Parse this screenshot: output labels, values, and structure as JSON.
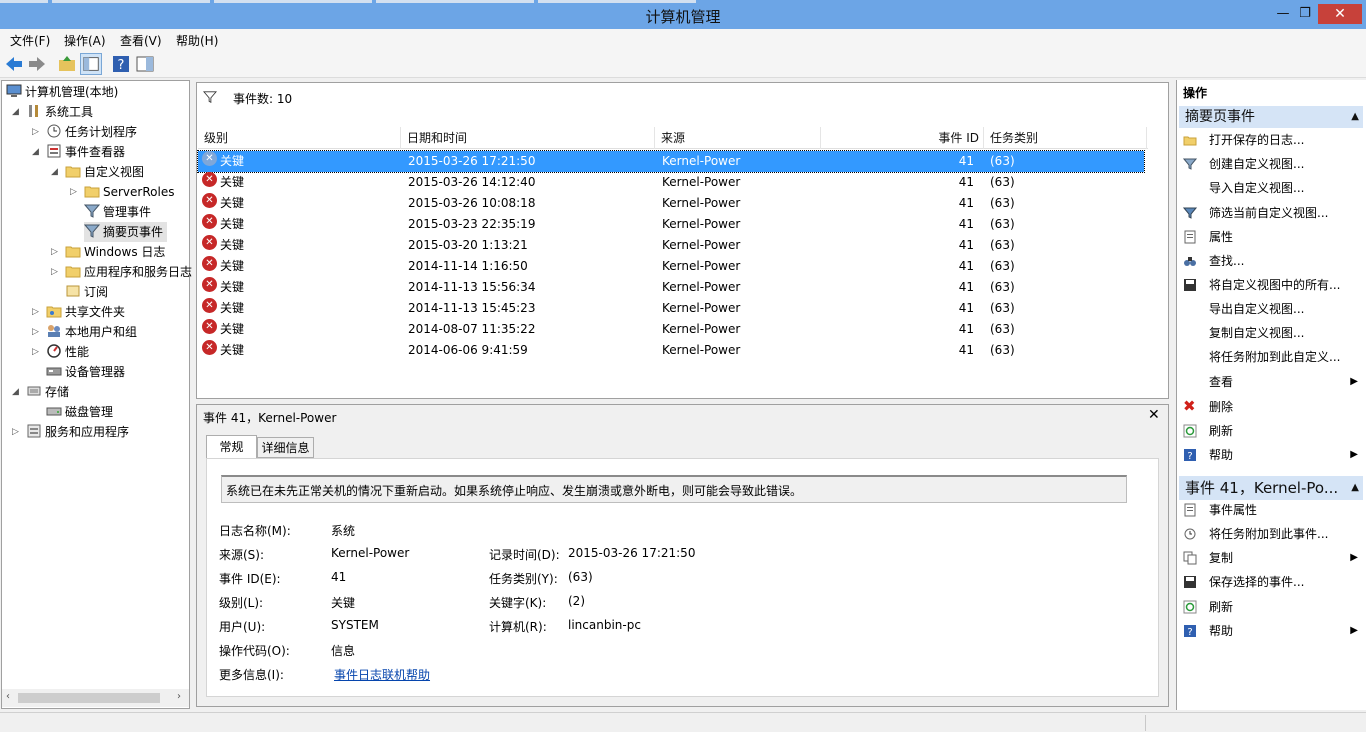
{
  "window": {
    "title": "计算机管理",
    "minimize": "—",
    "restore": "❐",
    "close": "✕"
  },
  "menu": [
    "文件(F)",
    "操作(A)",
    "查看(V)",
    "帮助(H)"
  ],
  "tree": [
    {
      "label": "计算机管理(本地)",
      "expander": ""
    },
    {
      "label": "系统工具",
      "expander": "◢"
    },
    {
      "label": "任务计划程序",
      "expander": "▷"
    },
    {
      "label": "事件查看器",
      "expander": "◢"
    },
    {
      "label": "自定义视图",
      "expander": "◢"
    },
    {
      "label": "ServerRoles",
      "expander": "▷"
    },
    {
      "label": "管理事件",
      "expander": ""
    },
    {
      "label": "摘要页事件",
      "expander": ""
    },
    {
      "label": "Windows 日志",
      "expander": "▷"
    },
    {
      "label": "应用程序和服务日志",
      "expander": "▷"
    },
    {
      "label": "订阅",
      "expander": ""
    },
    {
      "label": "共享文件夹",
      "expander": "▷"
    },
    {
      "label": "本地用户和组",
      "expander": "▷"
    },
    {
      "label": "性能",
      "expander": "▷"
    },
    {
      "label": "设备管理器",
      "expander": ""
    },
    {
      "label": "存储",
      "expander": "◢"
    },
    {
      "label": "磁盘管理",
      "expander": ""
    },
    {
      "label": "服务和应用程序",
      "expander": "▷"
    }
  ],
  "events": {
    "count_label": "事件数: 10",
    "columns": [
      "级别",
      "日期和时间",
      "来源",
      "事件 ID",
      "任务类别"
    ],
    "rows": [
      {
        "level": "关键",
        "datetime": "2015-03-26 17:21:50",
        "source": "Kernel-Power",
        "id": "41",
        "task": "(63)"
      },
      {
        "level": "关键",
        "datetime": "2015-03-26 14:12:40",
        "source": "Kernel-Power",
        "id": "41",
        "task": "(63)"
      },
      {
        "level": "关键",
        "datetime": "2015-03-26 10:08:18",
        "source": "Kernel-Power",
        "id": "41",
        "task": "(63)"
      },
      {
        "level": "关键",
        "datetime": "2015-03-23 22:35:19",
        "source": "Kernel-Power",
        "id": "41",
        "task": "(63)"
      },
      {
        "level": "关键",
        "datetime": "2015-03-20 1:13:21",
        "source": "Kernel-Power",
        "id": "41",
        "task": "(63)"
      },
      {
        "level": "关键",
        "datetime": "2014-11-14 1:16:50",
        "source": "Kernel-Power",
        "id": "41",
        "task": "(63)"
      },
      {
        "level": "关键",
        "datetime": "2014-11-13 15:56:34",
        "source": "Kernel-Power",
        "id": "41",
        "task": "(63)"
      },
      {
        "level": "关键",
        "datetime": "2014-11-13 15:45:23",
        "source": "Kernel-Power",
        "id": "41",
        "task": "(63)"
      },
      {
        "level": "关键",
        "datetime": "2014-08-07 11:35:22",
        "source": "Kernel-Power",
        "id": "41",
        "task": "(63)"
      },
      {
        "level": "关键",
        "datetime": "2014-06-06 9:41:59",
        "source": "Kernel-Power",
        "id": "41",
        "task": "(63)"
      }
    ]
  },
  "detail": {
    "title": "事件 41，Kernel-Power",
    "tabs": [
      "常规",
      "详细信息"
    ],
    "message": "系统已在未先正常关机的情况下重新启动。如果系统停止响应、发生崩溃或意外断电，则可能会导致此错误。",
    "fields": {
      "log_name_label": "日志名称(M):",
      "log_name": "系统",
      "source_label": "来源(S):",
      "source": "Kernel-Power",
      "logged_label": "记录时间(D):",
      "logged": "2015-03-26 17:21:50",
      "event_id_label": "事件 ID(E):",
      "event_id": "41",
      "task_label": "任务类别(Y):",
      "task": "(63)",
      "level_label": "级别(L):",
      "level": "关键",
      "keywords_label": "关键字(K):",
      "keywords": "(2)",
      "user_label": "用户(U):",
      "user": "SYSTEM",
      "computer_label": "计算机(R):",
      "computer": "lincanbin-pc",
      "opcode_label": "操作代码(O):",
      "opcode": "信息",
      "more_info_label": "更多信息(I):",
      "more_info_link": "事件日志联机帮助"
    }
  },
  "actions": {
    "header": "操作",
    "section1": "摘要页事件",
    "items1": [
      "打开保存的日志...",
      "创建自定义视图...",
      "导入自定义视图...",
      "筛选当前自定义视图...",
      "属性",
      "查找...",
      "将自定义视图中的所有...",
      "导出自定义视图...",
      "复制自定义视图...",
      "将任务附加到此自定义...",
      "查看",
      "删除",
      "刷新",
      "帮助"
    ],
    "section2": "事件 41，Kernel-Po...",
    "items2": [
      "事件属性",
      "将任务附加到此事件...",
      "复制",
      "保存选择的事件...",
      "刷新",
      "帮助"
    ]
  }
}
